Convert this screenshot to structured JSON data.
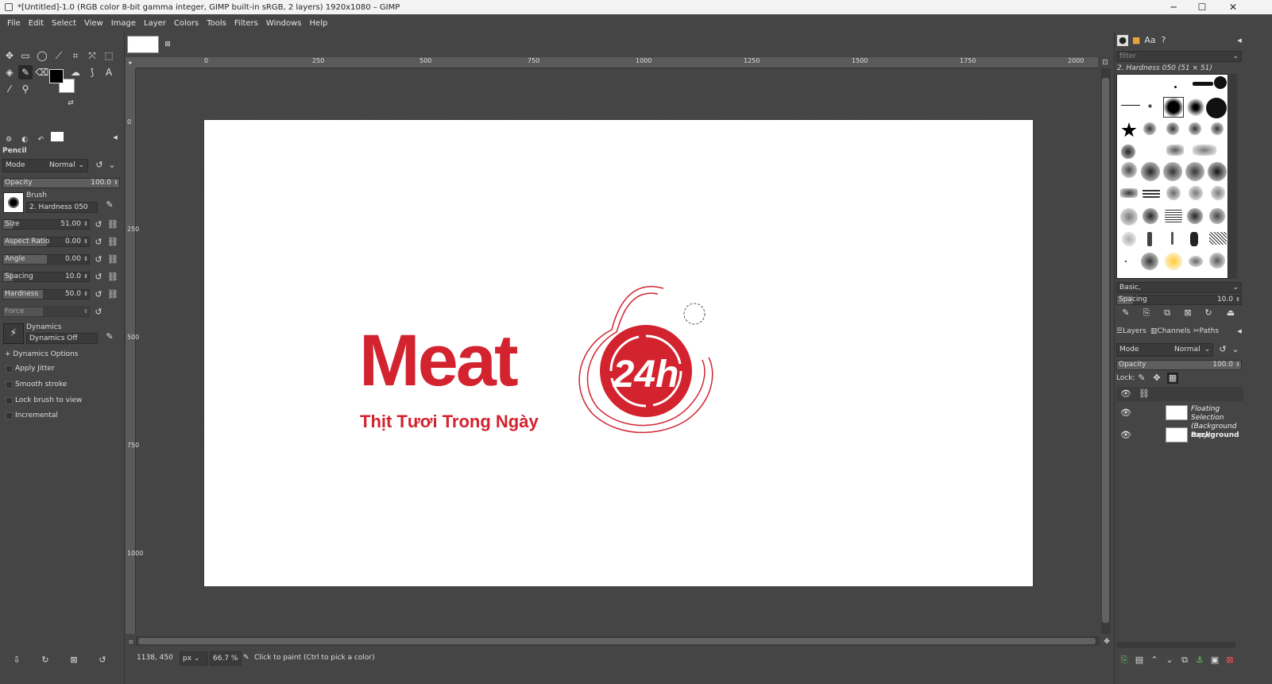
{
  "window": {
    "title": "*[Untitled]-1.0 (RGB color 8-bit gamma integer, GIMP built-in sRGB, 2 layers) 1920x1080 – GIMP",
    "minimize": "─",
    "maximize": "☐",
    "close": "✕"
  },
  "menu": [
    "File",
    "Edit",
    "Select",
    "View",
    "Image",
    "Layer",
    "Colors",
    "Tools",
    "Filters",
    "Windows",
    "Help"
  ],
  "tool_options": {
    "tool_name": "Pencil",
    "mode_label": "Mode",
    "mode_value": "Normal",
    "opacity_label": "Opacity",
    "opacity_value": "100.0",
    "brush_label": "Brush",
    "brush_value": "2. Hardness 050",
    "size_label": "Size",
    "size_value": "51.00",
    "aspect_label": "Aspect Ratio",
    "aspect_value": "0.00",
    "angle_label": "Angle",
    "angle_value": "0.00",
    "spacing_label": "Spacing",
    "spacing_value": "10.0",
    "hardness_label": "Hardness",
    "hardness_value": "50.0",
    "force_label": "Force",
    "dynamics_label": "Dynamics",
    "dynamics_value": "Dynamics Off",
    "dynamics_options": "Dynamics Options",
    "apply_jitter": "Apply Jitter",
    "smooth_stroke": "Smooth stroke",
    "lock_brush": "Lock brush to view",
    "incremental": "Incremental"
  },
  "ruler": {
    "h_ticks": [
      "0",
      "250",
      "500",
      "750",
      "1000",
      "1250",
      "1500",
      "1750",
      "2000"
    ],
    "v_ticks": [
      "0",
      "250",
      "500",
      "750",
      "1000"
    ]
  },
  "canvas_image": {
    "brand_text": "Meat",
    "badge_text": "24h",
    "tagline": "Thịt Tươi Trong Ngày"
  },
  "status": {
    "coords": "1138, 450",
    "unit": "px",
    "zoom": "66.7 %",
    "message": "Click to paint (Ctrl to pick a color)"
  },
  "brushes_panel": {
    "filter_placeholder": "filter",
    "selected_brush": "2. Hardness 050 (51 × 51)",
    "tag": "Basic,",
    "spacing_label": "Spacing",
    "spacing_value": "10.0"
  },
  "layers_panel": {
    "tabs": [
      "Layers",
      "Channels",
      "Paths"
    ],
    "mode_label": "Mode",
    "mode_value": "Normal",
    "opacity_label": "Opacity",
    "opacity_value": "100.0",
    "lock_label": "Lock:",
    "layers": [
      {
        "name": "Floating Selection (Background copy)"
      },
      {
        "name": "Background"
      }
    ]
  },
  "colors": {
    "accent": "#d2232f",
    "panel_bg": "#454545"
  }
}
